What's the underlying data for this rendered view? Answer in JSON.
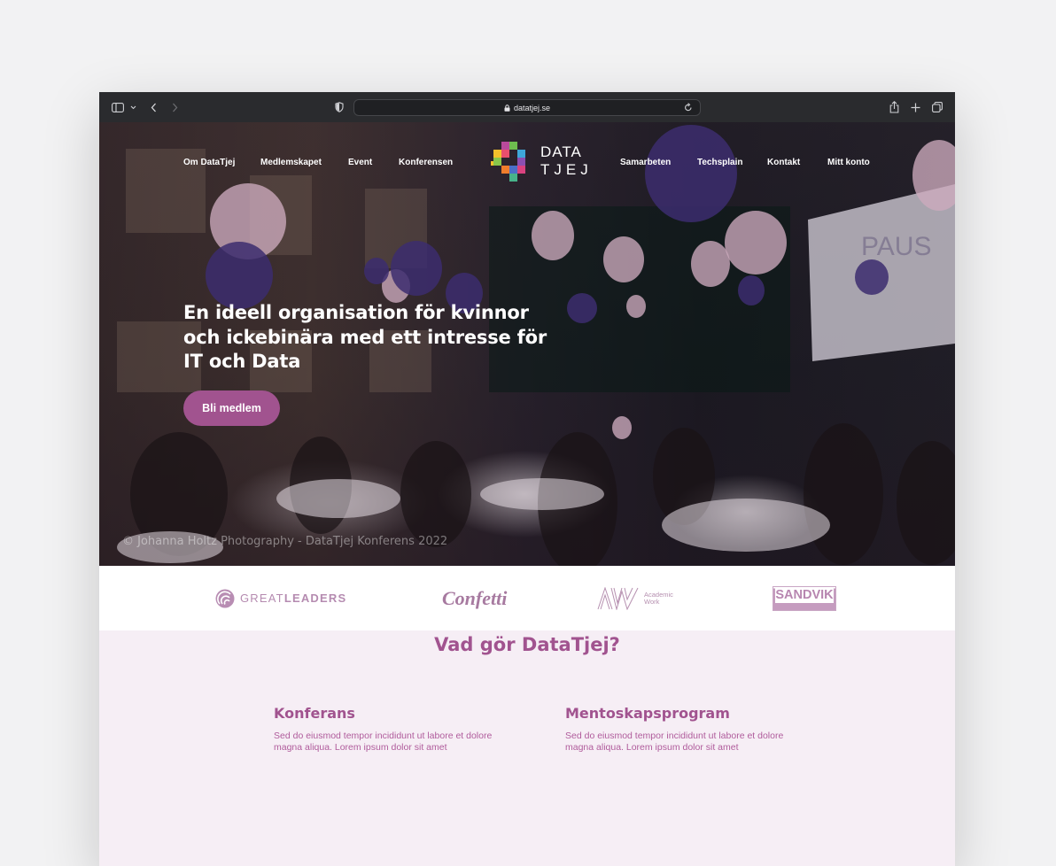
{
  "browser": {
    "url": "datatjej.se",
    "icons": [
      "sidebar-icon",
      "chevron-down-icon",
      "back-icon",
      "forward-icon",
      "shield-icon",
      "lock-icon",
      "reload-icon",
      "share-icon",
      "plus-icon",
      "tabs-icon"
    ]
  },
  "nav": {
    "left": [
      "Om DataTjej",
      "Medlemskapet",
      "Event",
      "Konferensen"
    ],
    "right": [
      "Samarbeten",
      "Techsplain",
      "Kontakt",
      "Mitt konto"
    ],
    "logo_line1": "DATA",
    "logo_line2": "TJEJ"
  },
  "hero": {
    "title": "En ideell organisation för kvinnor och ickebinära med ett intresse för IT och Data",
    "cta_label": "Bli medlem",
    "photo_credit": "© Johanna Holtz Photography - DataTjej Konferens 2022",
    "background_text": "PAUS"
  },
  "sponsors": {
    "greatleaders_light": "GREAT",
    "greatleaders_bold": "LEADERS",
    "confetti": "Confetti",
    "aw_mark": "AW",
    "aw_line1": "Academic",
    "aw_line2": "Work",
    "sandvik": "SANDVIK"
  },
  "section": {
    "title": "Vad gör DataTjej?",
    "features": [
      {
        "title": "Konferans",
        "text": "Sed do eiusmod tempor incididunt ut labore et dolore magna aliqua. Lorem ipsum dolor sit amet"
      },
      {
        "title": "Mentoskapsprogram",
        "text": "Sed do eiusmod tempor incididunt ut labore et dolore magna aliqua. Lorem ipsum dolor sit amet"
      }
    ]
  },
  "colors": {
    "brand": "#a1538f",
    "section_bg": "#f6eef5",
    "toolbar_bg": "#2a2b2e"
  }
}
